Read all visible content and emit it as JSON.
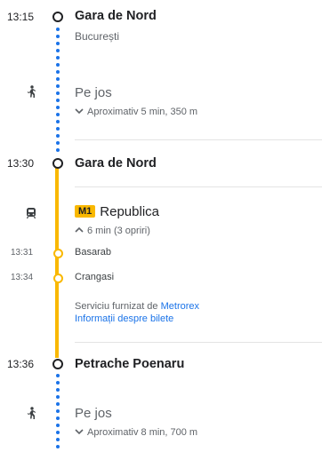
{
  "segments": {
    "start": {
      "time": "13:15",
      "title": "Gara de Nord",
      "subtitle": "București"
    },
    "walk1": {
      "label": "Pe jos",
      "meta": "Aproximativ 5 min, 350 m",
      "icon": "walk-icon"
    },
    "board": {
      "time": "13:30",
      "title": "Gara de Nord"
    },
    "transit": {
      "icon": "train-icon",
      "line_badge": "M1",
      "line_color": "#f9b800",
      "headsign": "Republica",
      "meta": "6 min (3 opriri)",
      "stops": [
        {
          "time": "13:31",
          "name": "Basarab"
        },
        {
          "time": "13:34",
          "name": "Crangasi"
        }
      ],
      "provider_prefix": "Serviciu furnizat de ",
      "provider_link": "Metrorex",
      "ticket_link": "Informații despre bilete"
    },
    "alight": {
      "time": "13:36",
      "title": "Petrache Poenaru"
    },
    "walk2": {
      "label": "Pe jos",
      "meta": "Aproximativ 8 min, 700 m",
      "icon": "walk-icon"
    }
  },
  "colors": {
    "walk_dots": "#1a73e8",
    "metro_line": "#f9b800",
    "link": "#1a73e8"
  }
}
